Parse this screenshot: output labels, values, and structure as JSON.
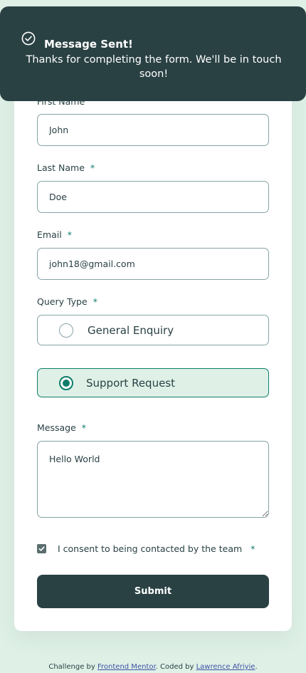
{
  "toast": {
    "title": "Message Sent!",
    "message": "Thanks for completing the form. We'll be in touch soon!"
  },
  "form": {
    "first_name": {
      "label": "First Name",
      "value": "John"
    },
    "last_name": {
      "label": "Last Name",
      "value": "Doe"
    },
    "email": {
      "label": "Email",
      "value": "john18@gmail.com"
    },
    "query_type": {
      "label": "Query Type",
      "options": [
        "General Enquiry",
        "Support Request"
      ],
      "selected": "Support Request"
    },
    "message": {
      "label": "Message",
      "value": "Hello World"
    },
    "consent": {
      "label": "I consent to being contacted by the team",
      "checked": true
    },
    "required_marker": "*",
    "submit_label": "Submit"
  },
  "footer": {
    "prefix": "Challenge by",
    "link1": "Frontend Mentor",
    "middle": ". Coded by",
    "link2": "Lawrence Afriyie",
    "suffix": "."
  },
  "colors": {
    "page_bg": "#dff1e7",
    "dark": "#2a4144",
    "accent": "#0c7d69",
    "border": "#87a3a6",
    "link": "#3e52a3"
  }
}
